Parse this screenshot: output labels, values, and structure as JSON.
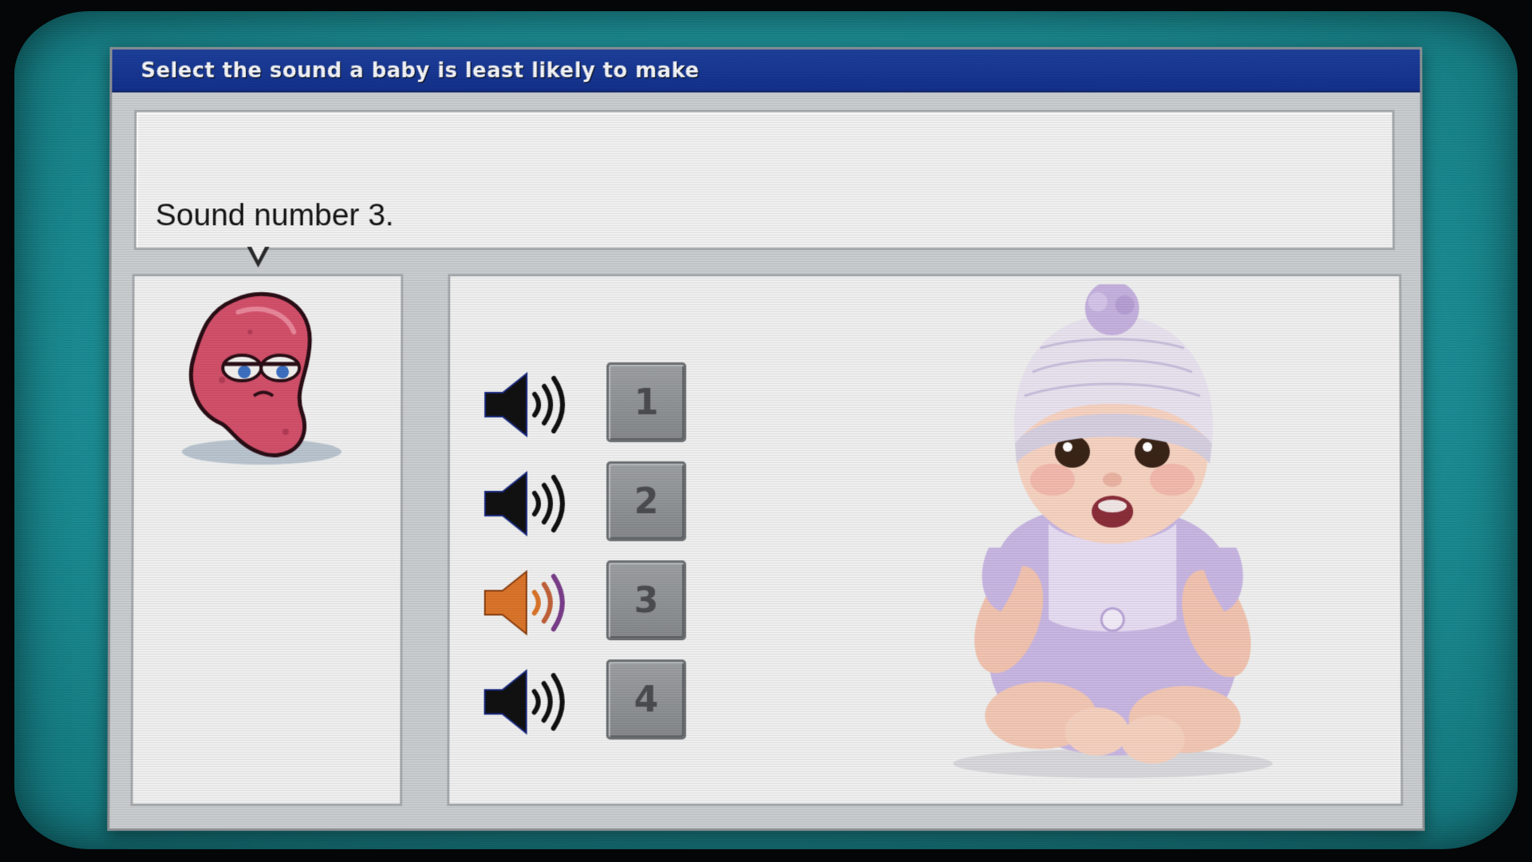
{
  "window": {
    "title": "Select the sound a baby is least likely to make"
  },
  "dialog": {
    "message": "Sound number 3."
  },
  "sounds": [
    {
      "label": "1",
      "active": false
    },
    {
      "label": "2",
      "active": false
    },
    {
      "label": "3",
      "active": true
    },
    {
      "label": "4",
      "active": false
    }
  ],
  "icons": {
    "speaker": "speaker-icon",
    "character": "bean-character",
    "baby": "baby-image"
  },
  "colors": {
    "bezel": "#1c8e95",
    "titlebar": "#13308a",
    "speaker_default": "#111111",
    "speaker_active": "#d9742a",
    "button": "#8f9295"
  }
}
